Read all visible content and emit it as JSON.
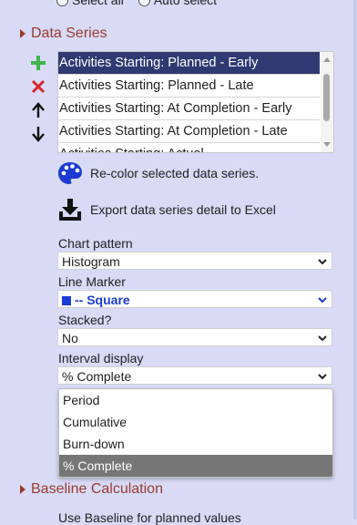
{
  "top_radios": {
    "select_all": "Select all",
    "auto_select": "Auto select"
  },
  "data_series": {
    "header": "Data Series",
    "items": [
      {
        "label": "Activities Starting: Planned - Early",
        "selected": true
      },
      {
        "label": "Activities Starting: Planned - Late",
        "selected": false
      },
      {
        "label": "Activities Starting: At Completion - Early",
        "selected": false
      },
      {
        "label": "Activities Starting: At Completion - Late",
        "selected": false
      },
      {
        "label": "Activities Starting: Actual",
        "selected": false
      }
    ],
    "recolor_label": "Re-color selected data series.",
    "export_label": "Export data series detail to Excel"
  },
  "fields": {
    "chart_pattern": {
      "label": "Chart pattern",
      "value": "Histogram"
    },
    "line_marker": {
      "label": "Line Marker",
      "value": "-- Square"
    },
    "stacked": {
      "label": "Stacked?",
      "value": "No"
    },
    "interval_display": {
      "label": "Interval display",
      "value": "% Complete",
      "options": [
        "Period",
        "Cumulative",
        "Burn-down",
        "% Complete"
      ]
    }
  },
  "baseline": {
    "header": "Baseline Calculation",
    "use_baseline_label": "Use Baseline for planned values"
  },
  "colors": {
    "accent_header": "#9a3b2e",
    "selected_item": "#2f3a72",
    "marker_blue": "#1a3bd6",
    "panel_bg": "#d8daf6"
  }
}
